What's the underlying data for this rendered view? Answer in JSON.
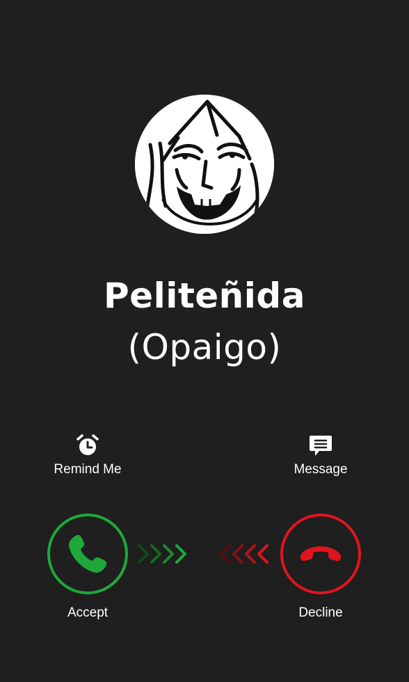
{
  "caller": {
    "name": "Peliteñida",
    "subtitle": "(Opaigo)"
  },
  "actions": {
    "remind_label": "Remind Me",
    "message_label": "Message"
  },
  "buttons": {
    "accept_label": "Accept",
    "decline_label": "Decline"
  },
  "colors": {
    "background": "#1f1f1f",
    "accept": "#1ea83a",
    "decline": "#e0141e"
  },
  "icons": {
    "remind": "alarm-clock-icon",
    "message": "chat-bubble-icon",
    "accept": "phone-icon",
    "decline": "phone-hangup-icon"
  }
}
